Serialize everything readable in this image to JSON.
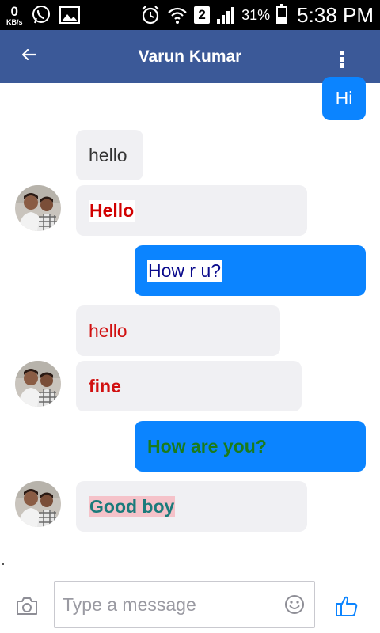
{
  "status_bar": {
    "data_speed_value": "0",
    "data_speed_unit": "KB/s",
    "sim_slot": "2",
    "battery_percent": "31%",
    "time": "5:38 PM",
    "battery_level": 0.31
  },
  "header": {
    "title": "Varun Kumar",
    "bg_color": "#3b5998"
  },
  "messages": [
    {
      "direction": "outgoing",
      "text": "Hi"
    },
    {
      "direction": "incoming",
      "text": "hello"
    },
    {
      "direction": "incoming",
      "text": "Hello",
      "style": "red bold on white highlight"
    },
    {
      "direction": "outgoing",
      "text": "How r u?",
      "style": "navy on white highlight"
    },
    {
      "direction": "incoming",
      "text": "hello",
      "style": "red"
    },
    {
      "direction": "incoming",
      "text": "fine",
      "style": "red bold"
    },
    {
      "direction": "outgoing",
      "text": "How are you?",
      "style": "green bold"
    },
    {
      "direction": "incoming",
      "text": "Good boy",
      "style": "teal bold on pink highlight"
    }
  ],
  "composer": {
    "placeholder": "Type a message"
  },
  "colors": {
    "outgoing_bubble": "#0b84ff",
    "incoming_bubble": "#f0f0f3",
    "accent": "#3b5998"
  },
  "icons": {
    "back": "back-arrow-icon",
    "menu": "overflow-menu-icon",
    "camera": "camera-icon",
    "emoji": "smiley-icon",
    "like": "thumbs-up-icon"
  }
}
